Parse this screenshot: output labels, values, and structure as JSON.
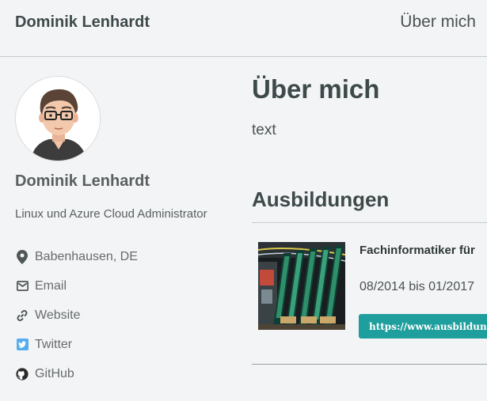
{
  "header": {
    "site_title": "Dominik Lenhardt",
    "nav": [
      {
        "label": "Über mich"
      }
    ]
  },
  "sidebar": {
    "name": "Dominik Lenhardt",
    "bio": "Linux und Azure Cloud Administrator",
    "links": [
      {
        "icon": "location-pin-icon",
        "label": "Babenhausen, DE"
      },
      {
        "icon": "envelope-icon",
        "label": "Email"
      },
      {
        "icon": "link-icon",
        "label": "Website"
      },
      {
        "icon": "twitter-icon",
        "label": "Twitter"
      },
      {
        "icon": "github-icon",
        "label": "GitHub"
      }
    ]
  },
  "main": {
    "title": "Über mich",
    "text": "text",
    "section_title": "Ausbildungen",
    "education": [
      {
        "title": "Fachinformatiker für",
        "date": "08/2014 bis 01/2017",
        "link": "https://www.ausbildung.d"
      }
    ]
  },
  "colors": {
    "background": "#f3f4f6",
    "accent": "#1e9e9c",
    "twitter": "#55acee"
  }
}
